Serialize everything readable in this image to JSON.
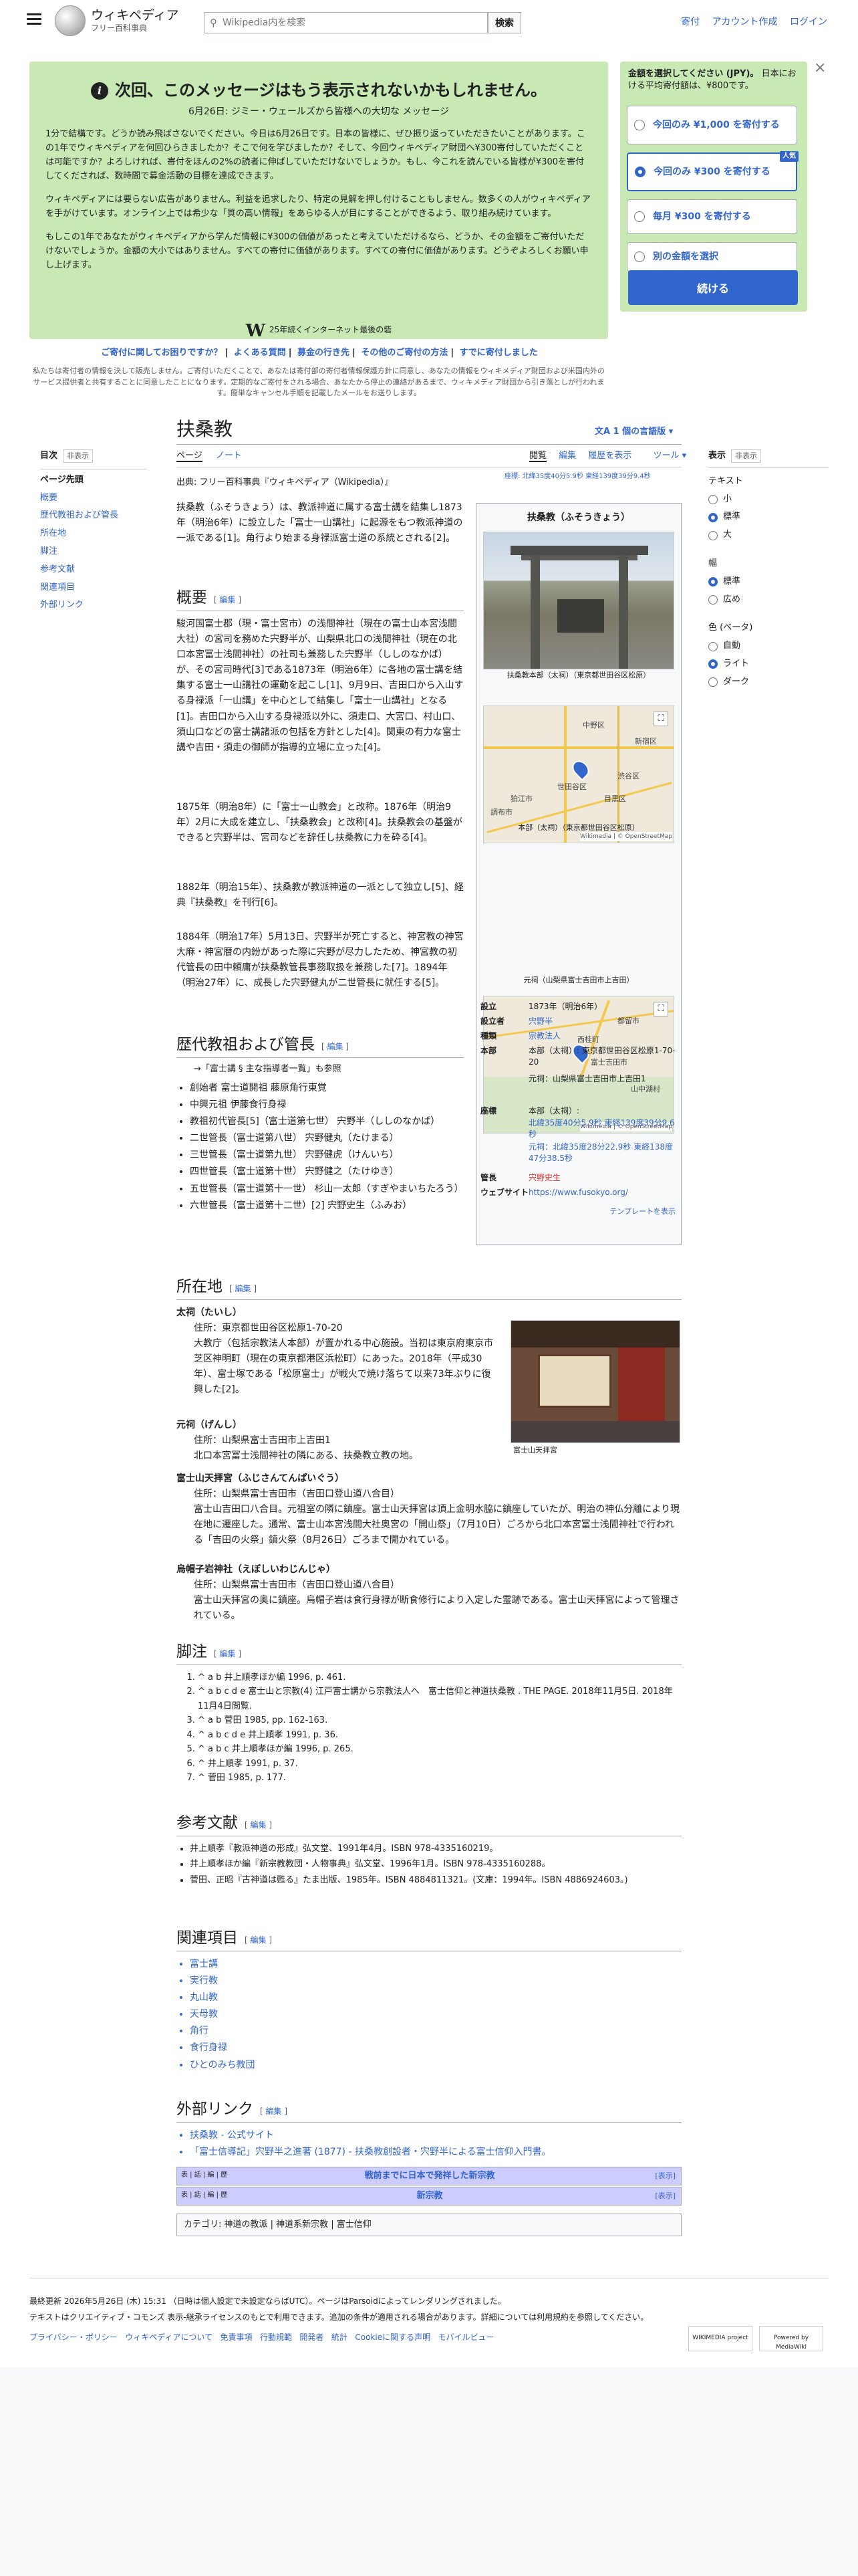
{
  "header": {
    "site_name": "ウィキペディア",
    "site_sub": "フリー百科事典",
    "search_placeholder": "Wikipedia内を検索",
    "search_button": "検索",
    "links": [
      "寄付",
      "アカウント作成",
      "ログイン"
    ]
  },
  "banner": {
    "title": "次回、このメッセージはもう表示されないかもしれません。",
    "subtitle": "6月26日: ジミー・ウェールズから皆様への大切な メッセージ",
    "p1": "1分で結構です。どうか読み飛ばさないでください。今日は6月26日です。日本の皆様に、ぜひ振り返っていただきたいことがあります。この1年でウィキペディアを何回ひらきましたか？そこで何を学びましたか？そして、今回ウィキペディア財団へ¥300寄付していただくことは可能ですか？よろしければ、寄付をほんの2%の読者に伸ばしていただけないでしょうか。もし、今これを読んでいる皆様が¥300を寄付してくだされば、数時間で募金活動の目標を達成できます。",
    "p2": "ウィキペディアには要らない広告がありません。利益を追求したり、特定の見解を押し付けることもしません。数多くの人がウィキペディアを手がけています。オンライン上では希少な「質の高い情報」をあらゆる人が目にすることができるよう、取り組み続けています。",
    "p3": "もしこの1年であなたがウィキペディアから学んだ情報に¥300の価値があったと考えていただけるなら、どうか、その金額をご寄付いただけないでしょうか。金額の大小ではありません。すべての寄付に価値があります。すべての寄付に価値があります。どうぞよろしくお願い申し上げます。",
    "footer": "25年続くインターネット最後の砦",
    "logo_letter": "W"
  },
  "donate": {
    "heading": "金額を選択してください (JPY)。",
    "heading_note": "日本における平均寄付額は、¥800です。",
    "options": [
      {
        "label": "今回のみ ¥1,000 を寄付する",
        "selected": false
      },
      {
        "label": "今回のみ ¥300 を寄付する",
        "selected": true,
        "badge": "人気"
      },
      {
        "label": "毎月 ¥300 を寄付する",
        "selected": false
      },
      {
        "label": "別の金額を選択",
        "selected": false
      }
    ],
    "continue": "続ける",
    "close": "×"
  },
  "banner_links": [
    "ご寄付に関してお困りですか？",
    "よくある質問",
    "募金の行き先",
    "その他のご寄付の方法",
    "すでに寄付しました"
  ],
  "banner_fine": "私たちは寄付者の情報を決して販売しません。ご寄付いただくことで、あなたは寄付部の寄付者情報保護方針に同意し、あなたの情報をウィキメディア財団および米国内外のサービス提供者と共有することに同意したことになります。定期的なご寄付をされる場合、あなたから停止の連絡があるまで、ウィキメディア財団から引き落としが行われます。簡単なキャンセル手順を記載したメールをお送りします。",
  "toc": {
    "title": "目次",
    "hide": "非表示",
    "items": [
      "ページ先頭",
      "概要",
      "歴代教祖および管長",
      "所在地",
      "脚注",
      "参考文献",
      "関連項目",
      "外部リンク"
    ]
  },
  "article": {
    "title": "扶桑教",
    "lang": "1 個の言語版",
    "tabs_left": [
      "ページ",
      "ノート"
    ],
    "tabs_right": [
      "閲覧",
      "編集",
      "履歴を表示",
      "ツール"
    ],
    "from": "出典: フリー百科事典『ウィキペディア（Wikipedia）』",
    "coords": "座標: 北緯35度40分5.9秒 東経139度39分9.4秒",
    "intro": "扶桑教（ふそうきょう）は、教派神道に属する富士講を結集し1873年（明治6年）に設立した「富士一山講社」に起源をもつ教派神道の一派である[1]。角行より始まる身禄派富士道の系統とされる[2]。",
    "edit": "編集",
    "sec_overview": "概要",
    "ov1": "駿河国富士郡（現・富士宮市）の浅間神社（現在の富士山本宮浅間大社）の宮司を務めた宍野半が、山梨県北口の浅間神社（現在の北口本宮冨士浅間神社）の社司も兼務した宍野半（ししのなかば）が、その宮司時代[3]である1873年（明治6年）に各地の富士講を結集する富士一山講社の運動を起こし[1]、9月9日、吉田口から入山する身禄派「一山講」を中心として結集し「富士一山講社」となる[1]。吉田口から入山する身禄派以外に、須走口、大宮口、村山口、須山口などの富士講諸派の包括を方針とした[4]。関東の有力な富士講や吉田・須走の御師が指導的立場に立った[4]。",
    "ov2": "1875年（明治8年）に「富士一山教会」と改称。1876年（明治9年）2月に大成を建立し、「扶桑教会」と改称[4]。扶桑教会の基盤ができると宍野半は、宮司などを辞任し扶桑教に力を砕る[4]。",
    "ov3": "1882年（明治15年）、扶桑教が教派神道の一派として独立し[5]、経典『扶桑教』を刊行[6]。",
    "ov4": "1884年（明治17年）5月13日、宍野半が死亡すると、神宮教の神宮大麻・神宮暦の内紛があった際に宍野が尽力したため、神宮教の初代管長の田中頼庸が扶桑教管長事務取扱を兼務した[7]。1894年（明治27年）に、成長した宍野健丸が二世管長に就任する[5]。",
    "sec_leaders": "歴代教祖および管長",
    "leaders_note": "→「富士講 § 主な指導者一覧」も参照",
    "leaders": [
      "創始者 富士道開祖 藤原角行東覚",
      "中興元祖 伊藤食行身禄",
      "教祖初代管長[5]（富士道第七世） 宍野半（ししのなかば）",
      "二世管長（富士道第八世） 宍野健丸（たけまる）",
      "三世管長（富士道第九世） 宍野健虎（けんいち）",
      "四世管長（富士道第十世） 宍野健之（たけゆき）",
      "五世管長（富士道第十一世） 杉山一太郎（すぎやまいちたろう）",
      "六世管長（富士道第十二世）[2] 宍野史生（ふみお）"
    ],
    "sec_location": "所在地",
    "loc": [
      {
        "name": "太祠（たいし）",
        "lines": [
          "住所：東京都世田谷区松原1-70-20",
          "大教庁（包括宗教法人本部）が置かれる中心施設。当初は東京府東京市芝区神明町（現在の東京都港区浜松町）にあった。2018年（平成30年）、富士塚である「松原富士」が戦火で焼け落ちて以来73年ぶりに復興した[2]。"
        ]
      },
      {
        "name": "元祠（げんし）",
        "lines": [
          "住所：山梨県富士吉田市上吉田1",
          "北口本宮冨士浅間神社の隣にある、扶桑教立教の地。"
        ]
      },
      {
        "name": "富士山天拝宮（ふじさんてんぱいぐう）",
        "lines": [
          "住所：山梨県富士吉田市（吉田口登山道八合目）",
          "富士山吉田口八合目。元祖室の隣に鎮座。富士山天拝宮は頂上金明水脇に鎮座していたが、明治の神仏分離により現在地に遷座した。通常、富士山本宮浅間大社奥宮の「開山祭」（7月10日）ごろから北口本宮冨士浅間神社で行われる「吉田の火祭」鎮火祭（8月26日）ごろまで開かれている。"
        ]
      },
      {
        "name": "烏帽子岩神社（えぼしいわじんじゃ）",
        "lines": [
          "住所：山梨県富士吉田市（吉田口登山道八合目）",
          "富士山天拝宮の奥に鎮座。烏帽子岩は食行身禄が断食修行により入定した霊跡である。富士山天拝宮によって管理されている。"
        ]
      }
    ],
    "photo_caption": "富士山天拝宮",
    "sec_notes": "脚注",
    "notes": [
      "^ a b 井上順孝ほか編 1996, p. 461.",
      "^ a b c d e 富士山と宗教(4) 江戸富士講から宗教法人へ　富士信仰と神道扶桑教 . THE PAGE. 2018年11月5日. 2018年11月4日閲覧.",
      "^ a b 菅田 1985, pp. 162-163.",
      "^ a b c d e 井上順孝 1991, p. 36.",
      "^ a b c 井上順孝ほか編 1996, p. 265.",
      "^ 井上順孝 1991, p. 37.",
      "^ 菅田 1985, p. 177."
    ],
    "sec_refs": "参考文献",
    "refs": [
      "井上順孝『教派神道の形成』弘文堂、1991年4月。ISBN 978-4335160219。",
      "井上順孝ほか編『新宗教教団・人物事典』弘文堂、1996年1月。ISBN 978-4335160288。",
      "菅田、正昭『古神道は甦る』たま出版、1985年。ISBN 4884811321。(文庫：1994年。ISBN 4886924603。)"
    ],
    "sec_related": "関連項目",
    "related": [
      "富士講",
      "実行教",
      "丸山教",
      "天母教",
      "角行",
      "食行身禄",
      "ひとのみち教団"
    ],
    "sec_external": "外部リンク",
    "external": [
      "扶桑教 - 公式サイト",
      "「富士信導記」宍野半之進著 (1877) - 扶桑教創設者・宍野半による富士信仰入門書。"
    ],
    "navboxes": [
      {
        "vte": "表 | 話 | 編 | 歴",
        "title": "戦前までに日本で発祥した新宗教",
        "toggle": "[表示]"
      },
      {
        "vte": "表 | 話 | 編 | 歴",
        "title": "新宗教",
        "toggle": "[表示]"
      }
    ],
    "categories": "カテゴリ: 神道の教派 | 神道系新宗教 | 富士信仰"
  },
  "infobox": {
    "title": "扶桑教（ふそうきょう）",
    "photo_caption": "扶桑教本部（太祠）（東京都世田谷区松原）",
    "map1_caption": "本部（太祠）（東京都世田谷区松原）",
    "map2_caption": "元祠（山梨県富士吉田市上吉田）",
    "map_credit": "Wikimedia | © OpenStreetMap",
    "map1_labels": [
      "中野区",
      "新宿区",
      "渋谷区",
      "世田谷区",
      "目黒区",
      "狛江市",
      "調布市"
    ],
    "map2_labels": [
      "都留市",
      "西桂町",
      "富士吉田市",
      "山中湖村"
    ],
    "rows": [
      {
        "k": "設立",
        "v": "1873年（明治6年）"
      },
      {
        "k": "設立者",
        "v": "宍野半"
      },
      {
        "k": "種類",
        "v": "宗教法人"
      },
      {
        "k": "本部",
        "v": "本部（太祠）: 東京都世田谷区松原1-70-20"
      },
      {
        "k": "",
        "v": "元祠：山梨県富士吉田市上吉田1"
      },
      {
        "k": "座標",
        "v": "本部（太祠）:"
      },
      {
        "k": "",
        "v": "北緯35度40分5.9秒 東経139度39分9.6秒"
      },
      {
        "k": "",
        "v": "元祠：北緯35度28分22.9秒 東経138度47分38.5秒"
      },
      {
        "k": "管長",
        "v": "宍野史生"
      },
      {
        "k": "ウェブサイト",
        "v": "https://www.fusokyo.org/"
      }
    ],
    "template": "テンプレートを表示"
  },
  "tools": {
    "title": "表示",
    "hide": "非表示",
    "text": "テキスト",
    "text_opts": [
      "小",
      "標準",
      "大"
    ],
    "width": "幅",
    "width_opts": [
      "標準",
      "広め"
    ],
    "color": "色 (ベータ)",
    "color_opts": [
      "自動",
      "ライト",
      "ダーク"
    ]
  },
  "footer": {
    "line1": "最終更新 2026年5月26日 (木) 15:31 （日時は個人設定で未設定ならばUTC）。ページはParsoidによってレンダリングされました。",
    "line2": "テキストはクリエイティブ・コモンズ 表示-継承ライセンスのもとで利用できます。追加の条件が適用される場合があります。詳細については利用規約を参照してください。",
    "links": [
      "プライバシー・ポリシー",
      "ウィキペディアについて",
      "免責事項",
      "行動規範",
      "開発者",
      "統計",
      "Cookieに関する声明",
      "モバイルビュー"
    ],
    "badge1": "WIKIMEDIA project",
    "badge2": "Powered by MediaWiki"
  }
}
